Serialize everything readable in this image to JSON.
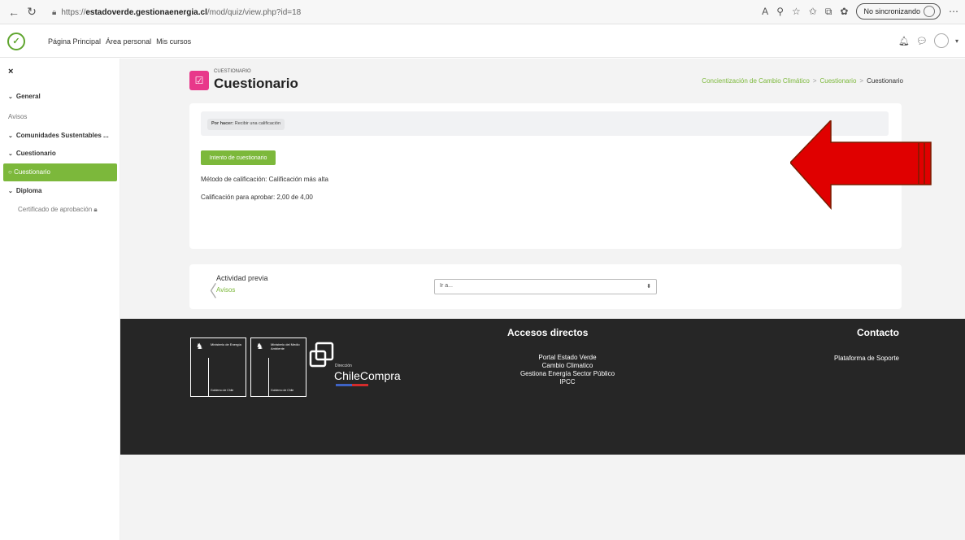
{
  "browser": {
    "url_prefix": "https://",
    "url_host": "estadoverde.gestionaenergia.cl",
    "url_path": "/mod/quiz/view.php?id=18",
    "sync_label": "No sincronizando"
  },
  "navbar": {
    "links": [
      "Página Principal",
      "Área personal",
      "Mis cursos"
    ]
  },
  "sidebar": {
    "close": "×",
    "items": [
      {
        "label": "General"
      },
      {
        "label": "Avisos"
      },
      {
        "label": "Comunidades Sustentables ..."
      },
      {
        "label": "Cuestionario"
      },
      {
        "label": "Cuestionario"
      },
      {
        "label": "Diploma"
      },
      {
        "label": "Certificado de aprobación"
      }
    ]
  },
  "header": {
    "kicker": "CUESTIONARIO",
    "title": "Cuestionario",
    "breadcrumb": [
      "Concientización de Cambio Climático",
      "Cuestionario",
      "Cuestionario"
    ]
  },
  "quiz": {
    "todo_label": "Por hacer:",
    "todo_text": "Recibir una calificación",
    "attempt_button": "Intento de cuestionario",
    "grading_method": "Método de calificación: Calificación más alta",
    "pass_grade": "Calificación para aprobar: 2,00 de 4,00"
  },
  "activity_nav": {
    "prev_label": "Actividad previa",
    "prev_link": "Avisos",
    "jump_placeholder": "Ir a..."
  },
  "footer": {
    "access_title": "Accesos directos",
    "access_links": [
      "Portal Estado Verde",
      "Cambio Climatico",
      "Gestiona Energía Sector Público",
      "IPCC"
    ],
    "contact_title": "Contacto",
    "contact_link": "Plataforma de Soporte",
    "logo1_ministry": "Ministerio de Energía",
    "logo2_ministry": "Ministerio del Medio Ambiente",
    "gob": "Gobierno de Chile",
    "cc_small": "Dirección",
    "cc_name": "ChileCompra"
  },
  "colors": {
    "accent": "#7cb83b",
    "quiz_icon": "#e8388a",
    "arrow": "#e00000",
    "footer_bg": "#262626"
  }
}
